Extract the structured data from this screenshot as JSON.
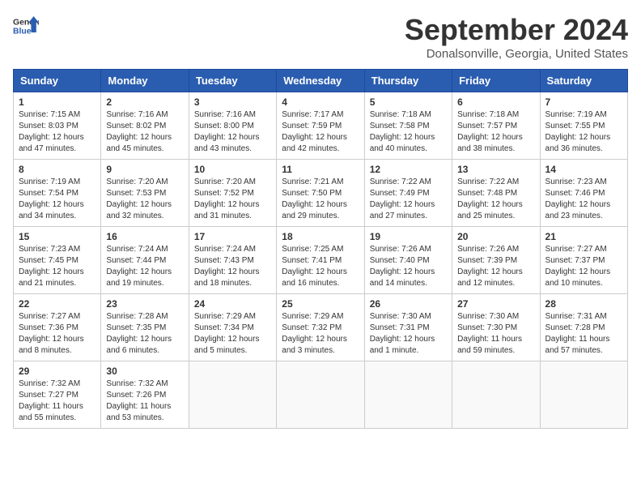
{
  "logo": {
    "general": "General",
    "blue": "Blue"
  },
  "title": "September 2024",
  "location": "Donalsonville, Georgia, United States",
  "days": [
    "Sunday",
    "Monday",
    "Tuesday",
    "Wednesday",
    "Thursday",
    "Friday",
    "Saturday"
  ],
  "weeks": [
    [
      {
        "day": "1",
        "sunrise": "7:15 AM",
        "sunset": "8:03 PM",
        "daylight": "12 hours and 47 minutes."
      },
      {
        "day": "2",
        "sunrise": "7:16 AM",
        "sunset": "8:02 PM",
        "daylight": "12 hours and 45 minutes."
      },
      {
        "day": "3",
        "sunrise": "7:16 AM",
        "sunset": "8:00 PM",
        "daylight": "12 hours and 43 minutes."
      },
      {
        "day": "4",
        "sunrise": "7:17 AM",
        "sunset": "7:59 PM",
        "daylight": "12 hours and 42 minutes."
      },
      {
        "day": "5",
        "sunrise": "7:18 AM",
        "sunset": "7:58 PM",
        "daylight": "12 hours and 40 minutes."
      },
      {
        "day": "6",
        "sunrise": "7:18 AM",
        "sunset": "7:57 PM",
        "daylight": "12 hours and 38 minutes."
      },
      {
        "day": "7",
        "sunrise": "7:19 AM",
        "sunset": "7:55 PM",
        "daylight": "12 hours and 36 minutes."
      }
    ],
    [
      {
        "day": "8",
        "sunrise": "7:19 AM",
        "sunset": "7:54 PM",
        "daylight": "12 hours and 34 minutes."
      },
      {
        "day": "9",
        "sunrise": "7:20 AM",
        "sunset": "7:53 PM",
        "daylight": "12 hours and 32 minutes."
      },
      {
        "day": "10",
        "sunrise": "7:20 AM",
        "sunset": "7:52 PM",
        "daylight": "12 hours and 31 minutes."
      },
      {
        "day": "11",
        "sunrise": "7:21 AM",
        "sunset": "7:50 PM",
        "daylight": "12 hours and 29 minutes."
      },
      {
        "day": "12",
        "sunrise": "7:22 AM",
        "sunset": "7:49 PM",
        "daylight": "12 hours and 27 minutes."
      },
      {
        "day": "13",
        "sunrise": "7:22 AM",
        "sunset": "7:48 PM",
        "daylight": "12 hours and 25 minutes."
      },
      {
        "day": "14",
        "sunrise": "7:23 AM",
        "sunset": "7:46 PM",
        "daylight": "12 hours and 23 minutes."
      }
    ],
    [
      {
        "day": "15",
        "sunrise": "7:23 AM",
        "sunset": "7:45 PM",
        "daylight": "12 hours and 21 minutes."
      },
      {
        "day": "16",
        "sunrise": "7:24 AM",
        "sunset": "7:44 PM",
        "daylight": "12 hours and 19 minutes."
      },
      {
        "day": "17",
        "sunrise": "7:24 AM",
        "sunset": "7:43 PM",
        "daylight": "12 hours and 18 minutes."
      },
      {
        "day": "18",
        "sunrise": "7:25 AM",
        "sunset": "7:41 PM",
        "daylight": "12 hours and 16 minutes."
      },
      {
        "day": "19",
        "sunrise": "7:26 AM",
        "sunset": "7:40 PM",
        "daylight": "12 hours and 14 minutes."
      },
      {
        "day": "20",
        "sunrise": "7:26 AM",
        "sunset": "7:39 PM",
        "daylight": "12 hours and 12 minutes."
      },
      {
        "day": "21",
        "sunrise": "7:27 AM",
        "sunset": "7:37 PM",
        "daylight": "12 hours and 10 minutes."
      }
    ],
    [
      {
        "day": "22",
        "sunrise": "7:27 AM",
        "sunset": "7:36 PM",
        "daylight": "12 hours and 8 minutes."
      },
      {
        "day": "23",
        "sunrise": "7:28 AM",
        "sunset": "7:35 PM",
        "daylight": "12 hours and 6 minutes."
      },
      {
        "day": "24",
        "sunrise": "7:29 AM",
        "sunset": "7:34 PM",
        "daylight": "12 hours and 5 minutes."
      },
      {
        "day": "25",
        "sunrise": "7:29 AM",
        "sunset": "7:32 PM",
        "daylight": "12 hours and 3 minutes."
      },
      {
        "day": "26",
        "sunrise": "7:30 AM",
        "sunset": "7:31 PM",
        "daylight": "12 hours and 1 minute."
      },
      {
        "day": "27",
        "sunrise": "7:30 AM",
        "sunset": "7:30 PM",
        "daylight": "11 hours and 59 minutes."
      },
      {
        "day": "28",
        "sunrise": "7:31 AM",
        "sunset": "7:28 PM",
        "daylight": "11 hours and 57 minutes."
      }
    ],
    [
      {
        "day": "29",
        "sunrise": "7:32 AM",
        "sunset": "7:27 PM",
        "daylight": "11 hours and 55 minutes."
      },
      {
        "day": "30",
        "sunrise": "7:32 AM",
        "sunset": "7:26 PM",
        "daylight": "11 hours and 53 minutes."
      },
      null,
      null,
      null,
      null,
      null
    ]
  ]
}
